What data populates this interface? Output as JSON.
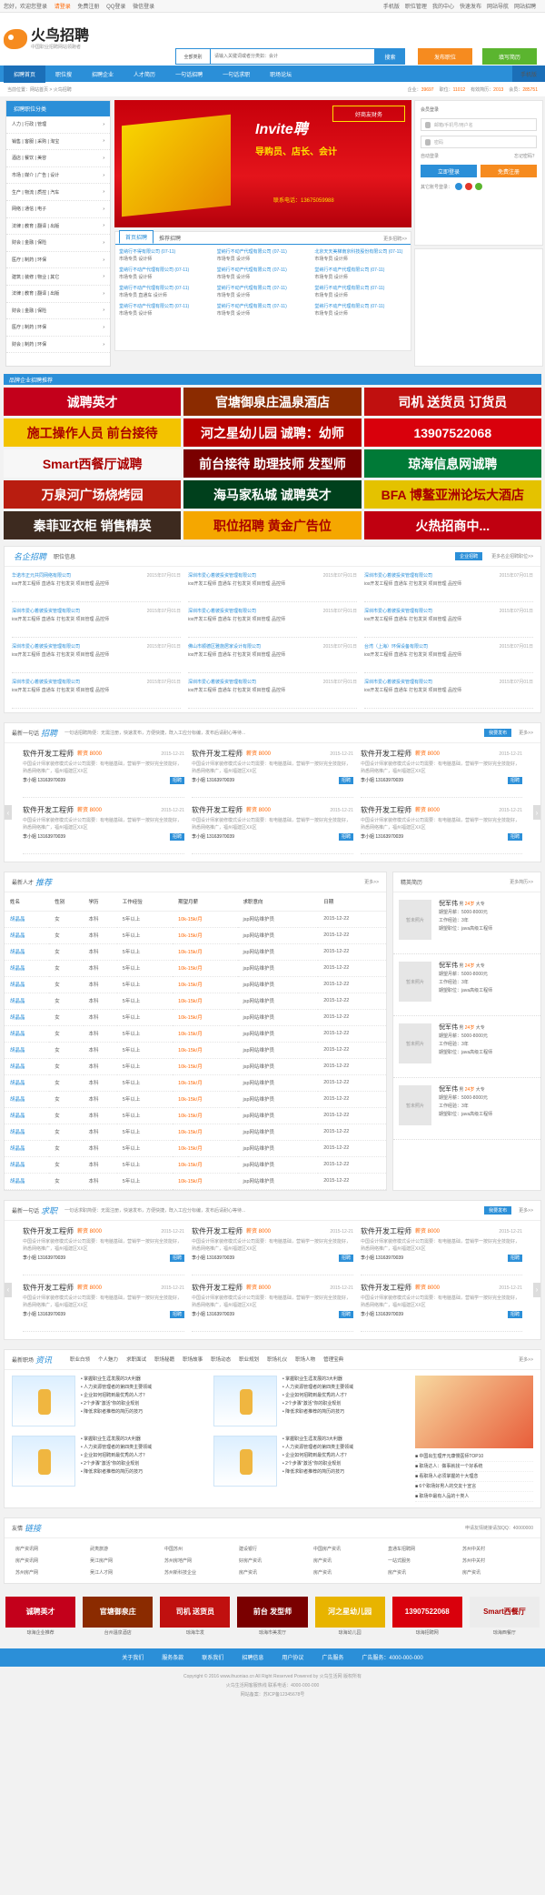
{
  "topbar": {
    "welcome": "您好，欢迎您登录",
    "login": "请登录",
    "free_reg": "免费注册",
    "qq_login": "QQ登录",
    "wechat_login": "微信登录",
    "right": [
      "手机版",
      "职位管理",
      "我的中心",
      "快速发布",
      "网站导航",
      "网站招聘"
    ]
  },
  "header": {
    "logo_title": "火鸟招聘",
    "logo_sub": "中国职业招聘网站领跑者",
    "search_select": "全部类别",
    "search_placeholder": "请输入关键词或者分类如：会计",
    "search_button": "搜索",
    "post_job": "发布职位",
    "fill_resume": "填写简历"
  },
  "nav": {
    "items": [
      "招聘首页",
      "职位搜",
      "招聘企业",
      "人才简历",
      "一句话招聘",
      "一句话求职",
      "职场论坛"
    ],
    "mobile": "手机版"
  },
  "crumb": {
    "path": "当前位置：网站首页 > 火鸟招聘",
    "stats": [
      {
        "label": "企业：",
        "value": "39697"
      },
      {
        "label": "职位：",
        "value": "11012"
      },
      {
        "label": "有效简历：",
        "value": "2013"
      },
      {
        "label": "会员：",
        "value": "285751"
      }
    ]
  },
  "sidebar": {
    "title": "招聘职位分类",
    "rows": [
      "人力 | 行政 | 管理",
      "销售 | 客服 | 采购 | 淘宝",
      "酒店 | 餐饮 | 美容",
      "市场 | 媒介 | 广告 | 设计",
      "生产 | 物流 | 质控 | 汽车",
      "网络 | 通信 | 电子",
      "法律 | 教育 | 翻译 | 出版",
      "财会 | 金融 | 保险",
      "医疗 | 制药 | 环保",
      "建筑 | 装修 | 物业 | 其它",
      "法律 | 教育 | 翻译 | 出版",
      "财会 | 金融 | 保险",
      "医疗 | 制药 | 环保",
      "财会 | 制药 | 环保"
    ]
  },
  "banner": {
    "invite": "Invite聘",
    "tagline": "导购员、店长、会计",
    "tel": "联系电话：13675059988",
    "seal": "好商友财务"
  },
  "login": {
    "title": "会员登录",
    "user_ph": "邮箱/手机号/用户名",
    "pass_ph": "密码",
    "remember": "自动登录",
    "forgot": "忘记密码？",
    "login_btn": "立即登录",
    "reg_btn": "免费注册",
    "other": "其它账号登录："
  },
  "company_tabs": {
    "tabs": [
      "首页招聘",
      "推荐招聘"
    ],
    "more": "更多招聘>>",
    "items": [
      {
        "name": "堂纳行不得有限公司",
        "date": "(07-11)",
        "pos": "市场专员  设计师"
      },
      {
        "name": "堂纳行不动产代理有限公司",
        "date": "(07-11)",
        "pos": "市场专员  设计师"
      },
      {
        "name": "北京天天美梯南京科技股份有限公司",
        "date": "(07-11)",
        "pos": "市场专员  设计师"
      },
      {
        "name": "堂纳行不动产代理有限公司",
        "date": "(07-11)",
        "pos": "市场专员  设计师"
      },
      {
        "name": "堂纳行不动产代理有限公司",
        "date": "(07-11)",
        "pos": "市场专员  设计师"
      },
      {
        "name": "堂纳行不动产代理有限公司",
        "date": "(07-11)",
        "pos": "市场专员  设计师"
      },
      {
        "name": "堂纳行不动产代理有限公司",
        "date": "(07-11)",
        "pos": "市场专员  直通车  设计师"
      },
      {
        "name": "堂纳行不动产代理有限公司",
        "date": "(07-11)",
        "pos": "市场专员  设计师"
      },
      {
        "name": "堂纳行不动产代理有限公司",
        "date": "(07-11)",
        "pos": "市场专员  设计师"
      },
      {
        "name": "堂纳行不动产代理有限公司",
        "date": "(07-11)",
        "pos": "市场专员  设计师"
      },
      {
        "name": "堂纳行不动产代理有限公司",
        "date": "(07-11)",
        "pos": "市场专员  设计师"
      },
      {
        "name": "堂纳行不动产代理有限公司",
        "date": "(07-11)",
        "pos": "市场专员  设计师"
      }
    ]
  },
  "brand": {
    "title": "品牌企业招聘推荐",
    "ads": [
      {
        "text": "诚聘英才",
        "bg": "#c3001b"
      },
      {
        "text": "官塘御泉庄温泉酒店",
        "bg": "#8b2b00"
      },
      {
        "text": "司机 送货员 订货员",
        "bg": "#c0100f"
      },
      {
        "text": "施工操作人员 前台接待",
        "bg": "#f3c300"
      },
      {
        "text": "河之星幼儿园 诚聘：幼师",
        "bg": "#b80000"
      },
      {
        "text": "13907522068",
        "bg": "#d9000c"
      },
      {
        "text": "Smart西餐厅诚聘",
        "bg": "#f7f7f7"
      },
      {
        "text": "前台接待 助理技师 发型师",
        "bg": "#7a0000"
      },
      {
        "text": "琼海信息网诚聘",
        "bg": "#007a37"
      },
      {
        "text": "万泉河广场烧烤园",
        "bg": "#b91d10"
      },
      {
        "text": "海马家私城 诚聘英才",
        "bg": "#00401c"
      },
      {
        "text": "BFA 博鳌亚洲论坛大酒店",
        "bg": "#e4c200"
      },
      {
        "text": "秦菲亚衣柜 销售精英",
        "bg": "#3d2a1f"
      },
      {
        "text": "职位招聘 黄金广告位",
        "bg": "#f5a700"
      },
      {
        "text": "火热招商中...",
        "bg": "#c00010"
      }
    ]
  },
  "famous": {
    "title": "名企招聘",
    "sub": "职位信息",
    "btn": "企业招聘",
    "more": "更多名企招聘职位>>",
    "items": [
      {
        "n": "华诺市正元共同网络有限公司",
        "d": "2015年07月01日",
        "p": "ios开发工程师  直通车  打包发货  项目管理  品控师"
      },
      {
        "n": "深圳市爱心着彼投资管理有限公司",
        "d": "2015年07月01日",
        "p": "ios开发工程师  直通车  打包发货  项目管理  品控师"
      },
      {
        "n": "深圳市爱心着彼投资管理有限公司",
        "d": "2015年07月01日",
        "p": "ios开发工程师  直通车  打包发货  项目管理  品控师"
      },
      {
        "n": "深圳市爱心着彼投资管理有限公司",
        "d": "2015年07月01日",
        "p": "ios开发工程师  直通车  打包发货  项目管理  品控师"
      },
      {
        "n": "深圳市爱心着彼投资管理有限公司",
        "d": "2015年07月01日",
        "p": "ios开发工程师  直通车  打包发货  项目管理  品控师"
      },
      {
        "n": "深圳市爱心着彼投资管理有限公司",
        "d": "2015年07月01日",
        "p": "ios开发工程师  直通车  打包发货  项目管理  品控师"
      },
      {
        "n": "深圳市爱心着彼投资管理有限公司",
        "d": "2015年07月01日",
        "p": "ios开发工程师  直通车  打包发货  项目管理  品控师"
      },
      {
        "n": "佛山市顺德区雅施居家设计有限公司",
        "d": "2015年07月01日",
        "p": "ios开发工程师  直通车  打包发货  项目管理  品控师"
      },
      {
        "n": "台湾（上海）环保设备有限公司",
        "d": "2015年07月01日",
        "p": "ios开发工程师  直通车  打包发货  项目管理  品控师"
      },
      {
        "n": "深圳市爱心着彼投资管理有限公司",
        "d": "2015年07月01日",
        "p": "ios开发工程师  直通车  打包发货  项目管理  品控师"
      },
      {
        "n": "深圳市爱心着彼投资管理有限公司",
        "d": "2015年07月01日",
        "p": "ios开发工程师  直通车  打包发货  项目管理  品控师"
      },
      {
        "n": "深圳市爱心着彼投资管理有限公司",
        "d": "2015年07月01日",
        "p": "ios开发工程师  直通车  打包发货  项目管理  品控师"
      },
      {
        "n": "深圳市爱心着彼投资管理有限公司",
        "d": "2015年07月01日",
        "p": "ios开发工程师  直通车  打包发货  项目管理  品控师"
      },
      {
        "n": "深圳市爱心着彼投资管理有限公司",
        "d": "2015年07月01日",
        "p": "ios开发工程师  直通车  打包发货  项目管理  品控师"
      },
      {
        "n": "深圳市爱心着彼投资管理有限公司",
        "d": "2015年07月01日",
        "p": "ios开发工程师  直通车  打包发货  项目管理  品控师"
      }
    ]
  },
  "quickjob": {
    "title": "最新一句话",
    "italic": "招聘",
    "slogan": "一句话招聘简便：无需注册，快速发布，方便快捷，既入工应分标编，发布后请耐心等待...",
    "btn": "我要发布",
    "more": "更多>>",
    "items": [
      {
        "t": "软件开发工程师",
        "s": "薪资 8000",
        "date": "2015-12-21",
        "desc": "中国设计师家装修模式设计公司需要：有电脑基础，营销学一按好完全技能好，熟悉网络推广，福州福建区XX区",
        "person": "李小姐",
        "tel": "13163970039",
        "tag": "招聘"
      },
      {
        "t": "软件开发工程师",
        "s": "薪资 8000",
        "date": "2015-12-21",
        "desc": "中国设计师家装修模式设计公司需要：有电脑基础，营销学一按好完全技能好，熟悉网络推广，福州福建区XX区",
        "person": "李小姐",
        "tel": "13163970039",
        "tag": "招聘"
      },
      {
        "t": "软件开发工程师",
        "s": "薪资 8000",
        "date": "2015-12-21",
        "desc": "中国设计师家装修模式设计公司需要：有电脑基础，营销学一按好完全技能好，熟悉网络推广，福州福建区XX区",
        "person": "李小姐",
        "tel": "13163970039",
        "tag": "招聘"
      },
      {
        "t": "软件开发工程师",
        "s": "薪资 8000",
        "date": "2015-12-21",
        "desc": "中国设计师家装修模式设计公司需要：有电脑基础，营销学一按好完全技能好，熟悉网络推广，福州福建区XX区",
        "person": "李小姐",
        "tel": "13163970039",
        "tag": "招聘"
      },
      {
        "t": "软件开发工程师",
        "s": "薪资 8000",
        "date": "2015-12-21",
        "desc": "中国设计师家装修模式设计公司需要：有电脑基础，营销学一按好完全技能好，熟悉网络推广，福州福建区XX区",
        "person": "李小姐",
        "tel": "13163970039",
        "tag": "招聘"
      },
      {
        "t": "软件开发工程师",
        "s": "薪资 8000",
        "date": "2015-12-21",
        "desc": "中国设计师家装修模式设计公司需要：有电脑基础，营销学一按好完全技能好，熟悉网络推广，福州福建区XX区",
        "person": "李小姐",
        "tel": "13163970039",
        "tag": "招聘"
      }
    ]
  },
  "talents": {
    "title": "最新人才",
    "italic": "推荐",
    "more": "更多>>",
    "headers": [
      "姓名",
      "性别",
      "学历",
      "工作经验",
      "期望月薪",
      "求职意向",
      "日期"
    ],
    "rows": [
      [
        "胡晶晶",
        "女",
        "本科",
        "5年以上",
        "10k-15k/月",
        "jsp网站维护员",
        "2015-12-22"
      ],
      [
        "胡晶晶",
        "女",
        "本科",
        "5年以上",
        "10k-15k/月",
        "jsp网站维护员",
        "2015-12-22"
      ],
      [
        "胡晶晶",
        "女",
        "本科",
        "5年以上",
        "10k-15k/月",
        "jsp网站维护员",
        "2015-12-22"
      ],
      [
        "胡晶晶",
        "女",
        "本科",
        "5年以上",
        "10k-15k/月",
        "jsp网站维护员",
        "2015-12-22"
      ],
      [
        "胡晶晶",
        "女",
        "本科",
        "5年以上",
        "10k-15k/月",
        "jsp网站维护员",
        "2015-12-22"
      ],
      [
        "胡晶晶",
        "女",
        "本科",
        "5年以上",
        "10k-15k/月",
        "jsp网站维护员",
        "2015-12-22"
      ],
      [
        "胡晶晶",
        "女",
        "本科",
        "5年以上",
        "10k-15k/月",
        "jsp网站维护员",
        "2015-12-22"
      ],
      [
        "胡晶晶",
        "女",
        "本科",
        "5年以上",
        "10k-15k/月",
        "jsp网站维护员",
        "2015-12-22"
      ],
      [
        "胡晶晶",
        "女",
        "本科",
        "5年以上",
        "10k-15k/月",
        "jsp网站维护员",
        "2015-12-22"
      ],
      [
        "胡晶晶",
        "女",
        "本科",
        "5年以上",
        "10k-15k/月",
        "jsp网站维护员",
        "2015-12-22"
      ],
      [
        "胡晶晶",
        "女",
        "本科",
        "5年以上",
        "10k-15k/月",
        "jsp网站维护员",
        "2015-12-22"
      ],
      [
        "胡晶晶",
        "女",
        "本科",
        "5年以上",
        "10k-15k/月",
        "jsp网站维护员",
        "2015-12-22"
      ],
      [
        "胡晶晶",
        "女",
        "本科",
        "5年以上",
        "10k-15k/月",
        "jsp网站维护员",
        "2015-12-22"
      ],
      [
        "胡晶晶",
        "女",
        "本科",
        "5年以上",
        "10k-15k/月",
        "jsp网站维护员",
        "2015-12-22"
      ],
      [
        "胡晶晶",
        "女",
        "本科",
        "5年以上",
        "10k-15k/月",
        "jsp网站维护员",
        "2015-12-22"
      ],
      [
        "胡晶晶",
        "女",
        "本科",
        "5年以上",
        "10k-15k/月",
        "jsp网站维护员",
        "2015-12-22"
      ],
      [
        "胡晶晶",
        "女",
        "本科",
        "5年以上",
        "10k-15k/月",
        "jsp网站维护员",
        "2015-12-22"
      ]
    ]
  },
  "fameside": {
    "title": "精英简历",
    "more": "更多简历>>",
    "items": [
      {
        "avatar": "暂未照片",
        "name": "倪军伟",
        "sex": "男",
        "age": "24岁",
        "edu": "大专",
        "l1": "期望月薪：5000-8000元",
        "l2": "工作经验：3年",
        "l3": "期望职位：java高级工程师"
      },
      {
        "avatar": "暂未照片",
        "name": "倪军伟",
        "sex": "男",
        "age": "24岁",
        "edu": "大专",
        "l1": "期望月薪：5000-8000元",
        "l2": "工作经验：3年",
        "l3": "期望职位：java高级工程师"
      },
      {
        "avatar": "暂未照片",
        "name": "倪军伟",
        "sex": "男",
        "age": "24岁",
        "edu": "大专",
        "l1": "期望月薪：5000-8000元",
        "l2": "工作经验：3年",
        "l3": "期望职位：java高级工程师"
      },
      {
        "avatar": "暂未照片",
        "name": "倪军伟",
        "sex": "男",
        "age": "24岁",
        "edu": "大专",
        "l1": "期望月薪：5000-8000元",
        "l2": "工作经验：3年",
        "l3": "期望职位：java高级工程师"
      }
    ]
  },
  "quickseek": {
    "title": "最新一句话",
    "italic": "求职",
    "slogan": "一句话求职简便：无需注册，快速发布，方便快捷，既入工应分标编，发布后请耐心等待...",
    "btn": "我要发布",
    "more": "更多>>"
  },
  "news": {
    "title": "最新职场",
    "italic": "资讯",
    "tabs": [
      "职业白领",
      "个人魅力",
      "求职面试",
      "职场秘籍",
      "职场故事",
      "职场动态",
      "职业规划",
      "职场礼仪",
      "职场人物",
      "管理宝典"
    ],
    "more": "更多>>",
    "list": [
      "掌握职业生涯发展的3大利器",
      "人力资源管理者的第四类主要领域",
      "企业如何招聘到最优秀的人才？",
      "2个步骤“激活”你的职业规划",
      "降低求职者推荐的简历的技巧"
    ],
    "right": [
      "中国出生理开元康慢医师TOP10",
      "职场达人：做事就找一个好系统",
      "看职场人必须掌握的十大理念",
      "6个职场好男人的交友十宣言",
      "职场中最有人品的十类人"
    ]
  },
  "friendlinks": {
    "title": "友情",
    "italic": "链接",
    "apply": "申请友情链接请加QQ：40000000",
    "items": [
      "房产资讯网",
      "武夷旅游",
      "中国苏州",
      "建设银行",
      "中国房产资讯",
      "直通车招聘网",
      "苏州中关村",
      "房产资讯网",
      "吴江房产网",
      "苏州房地产网",
      "好房产资讯",
      "房产资讯",
      "一站式服务",
      "苏州中关村",
      "苏州房产网",
      "吴江人才网",
      "苏州新科技企业",
      "房产资讯",
      "房产资讯",
      "房产资讯",
      "房产资讯"
    ]
  },
  "logos": [
    {
      "text": "诚聘英才",
      "cap": "琼海企业推荐",
      "bg": "#c3001b"
    },
    {
      "text": "官塘御泉庄",
      "cap": "台州温泉酒店",
      "bg": "#8b2b00"
    },
    {
      "text": "司机 送货员",
      "cap": "琼海华发",
      "bg": "#c0100f"
    },
    {
      "text": "前台 发型师",
      "cap": "琼海市美发厅",
      "bg": "#7a0000"
    },
    {
      "text": "河之星幼儿园",
      "cap": "琼海幼儿园",
      "bg": "#e8b400"
    },
    {
      "text": "13907522068",
      "cap": "琼海招聘网",
      "bg": "#d9000c"
    },
    {
      "text": "Smart西餐厅",
      "cap": "琼海西餐厅",
      "bg": "#ececec"
    }
  ],
  "footer": {
    "nav": [
      "关于我们",
      "服务条款",
      "联系我们",
      "招聘信息",
      "用户协议",
      "广告服务",
      "广告服务：4000-000-000"
    ],
    "copy": "Copyright © 2016 www.ihuoniao.cn All Right Reserved Powered by 火鸟生活网 版权所有",
    "l2": "火鸟生活网客服热线 联系电话：4000-000-000",
    "l3": "网站备案：苏ICP备12345678号"
  }
}
